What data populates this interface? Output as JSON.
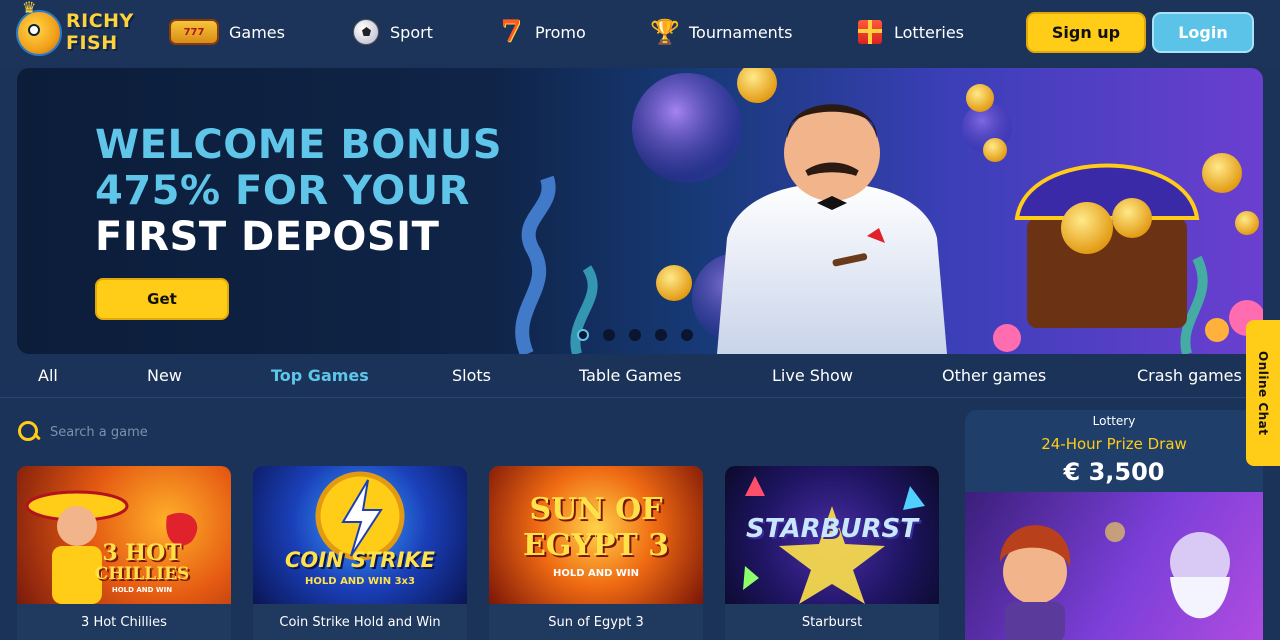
{
  "header": {
    "logo_text_line1": "RICHY",
    "logo_text_line2": "FISH",
    "nav": [
      {
        "label": "Games",
        "icon": "slot-machine-icon"
      },
      {
        "label": "Sport",
        "icon": "soccer-ball-icon"
      },
      {
        "label": "Promo",
        "icon": "seven-icon"
      },
      {
        "label": "Tournaments",
        "icon": "trophy-icon"
      },
      {
        "label": "Lotteries",
        "icon": "gift-icon"
      }
    ],
    "signup_label": "Sign up",
    "login_label": "Login"
  },
  "hero": {
    "line1": "WELCOME BONUS",
    "line2": "475% FOR YOUR",
    "line3": "FIRST DEPOSIT",
    "cta_label": "Get",
    "slides_count": 5,
    "active_slide": 1
  },
  "categories": [
    {
      "label": "All",
      "active": false
    },
    {
      "label": "New",
      "active": false
    },
    {
      "label": "Top Games",
      "active": true
    },
    {
      "label": "Slots",
      "active": false
    },
    {
      "label": "Table Games",
      "active": false
    },
    {
      "label": "Live Show",
      "active": false
    },
    {
      "label": "Other games",
      "active": false
    },
    {
      "label": "Crash games",
      "active": false
    }
  ],
  "search": {
    "placeholder": "Search a game",
    "value": ""
  },
  "games": [
    {
      "name": "3 Hot Chillies",
      "art_line1": "3 HOT",
      "art_line2": "CHILLIES",
      "art_line3": "HOLD AND WIN"
    },
    {
      "name": "Coin Strike Hold and Win",
      "art_line1": "COIN STRIKE",
      "art_line2": "HOLD AND WIN 3x3"
    },
    {
      "name": "Sun of Egypt 3",
      "art_line1": "SUN OF",
      "art_line2": "EGYPT 3",
      "art_line3": "HOLD AND WIN"
    },
    {
      "name": "Starburst",
      "art_line1": "STARBURST"
    }
  ],
  "lottery": {
    "label": "Lottery",
    "title": "24-Hour Prize Draw",
    "amount": "€ 3,500"
  },
  "chat": {
    "label": "Online Chat"
  },
  "colors": {
    "background": "#1b3358",
    "accent_yellow": "#ffcc17",
    "accent_cyan": "#5fc6ea"
  }
}
